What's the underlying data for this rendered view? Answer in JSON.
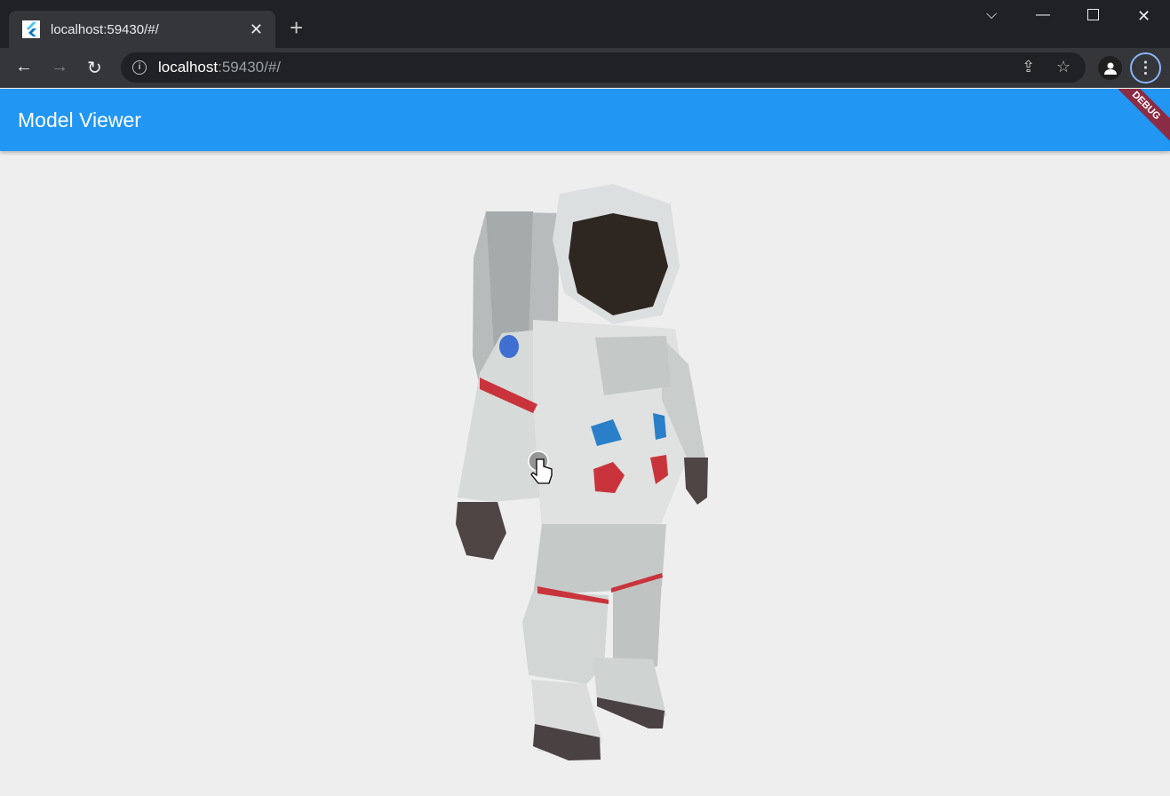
{
  "browser": {
    "tab_title": "localhost:59430/#/",
    "url_host": "localhost",
    "url_rest": ":59430/#/",
    "icons": [
      "back-icon",
      "forward-icon",
      "reload-icon",
      "info-icon",
      "share-icon",
      "star-icon",
      "profile-icon",
      "menu-icon"
    ]
  },
  "app": {
    "title": "Model Viewer",
    "debug_banner": "DEBUG",
    "primary_color": "#2196f3"
  }
}
